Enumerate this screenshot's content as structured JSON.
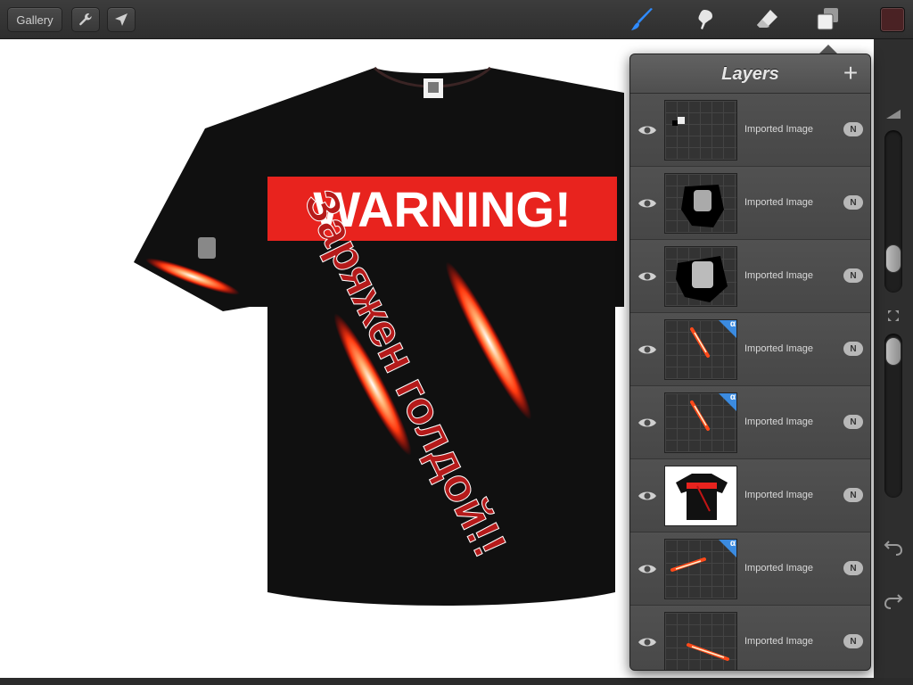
{
  "toolbar": {
    "gallery_label": "Gallery",
    "wrench_icon": "wrench-icon",
    "share_icon": "arrow-icon",
    "brush_icon": "brush-icon",
    "smudge_icon": "smudge-icon",
    "eraser_icon": "eraser-icon",
    "layers_icon": "layers-icon",
    "current_color": "#4a2224",
    "brush_active_color": "#2f8bff"
  },
  "canvas": {
    "banner_text": "WARNING!",
    "diagonal_text": "Заряжен голдой!!"
  },
  "layers_panel": {
    "title": "Layers",
    "add_label": "+",
    "layers": [
      {
        "name": "Imported Image",
        "blend": "N",
        "thumb": "logo-small",
        "alpha_lock": false
      },
      {
        "name": "Imported Image",
        "blend": "N",
        "thumb": "logo-black",
        "alpha_lock": false
      },
      {
        "name": "Imported Image",
        "blend": "N",
        "thumb": "logo-black2",
        "alpha_lock": false
      },
      {
        "name": "Imported Image",
        "blend": "N",
        "thumb": "streak",
        "alpha_lock": true
      },
      {
        "name": "Imported Image",
        "blend": "N",
        "thumb": "streak",
        "alpha_lock": true
      },
      {
        "name": "Imported Image",
        "blend": "N",
        "thumb": "tshirt",
        "alpha_lock": false
      },
      {
        "name": "Imported Image",
        "blend": "N",
        "thumb": "streak-flat",
        "alpha_lock": true
      },
      {
        "name": "Imported Image",
        "blend": "N",
        "thumb": "streak-flat2",
        "alpha_lock": false
      }
    ],
    "alpha_symbol": "α"
  },
  "sidebar": {
    "size_icon": "triangle-icon",
    "swap_icon": "arrows-icon",
    "undo_icon": "undo-icon",
    "redo_icon": "redo-icon"
  }
}
